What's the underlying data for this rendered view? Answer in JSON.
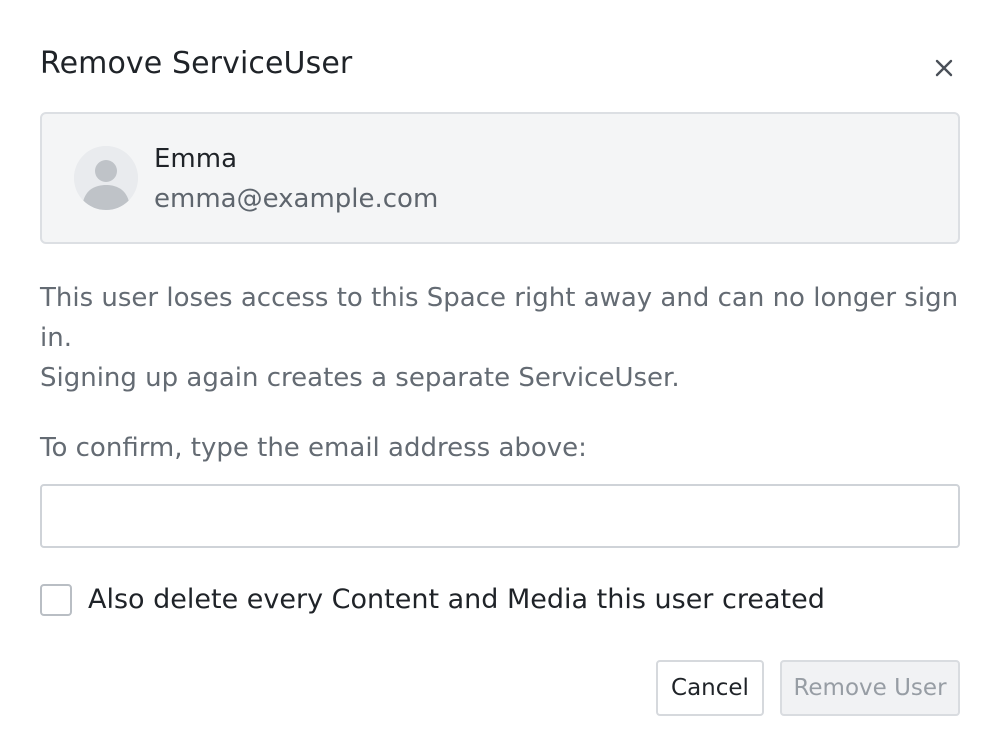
{
  "dialog": {
    "title": "Remove ServiceUser",
    "close_icon": "close-icon"
  },
  "user": {
    "avatar_icon": "user-avatar-icon",
    "name": "Emma",
    "email": "emma@example.com"
  },
  "description": {
    "line1": "This user loses access to this Space right away and can no longer sign in.",
    "line2": "Signing up again creates a separate ServiceUser."
  },
  "confirm": {
    "label": "To confirm, type the email address above:",
    "value": "",
    "placeholder": ""
  },
  "delete_content": {
    "label": "Also delete every Content and Media this user created",
    "checked": false
  },
  "actions": {
    "cancel_label": "Cancel",
    "remove_label": "Remove User",
    "remove_disabled": true
  },
  "colors": {
    "text_primary": "#1f2328",
    "text_secondary": "#646b73",
    "card_background": "#f4f5f6",
    "border": "#dcdfe3",
    "disabled_text": "#979da4"
  }
}
